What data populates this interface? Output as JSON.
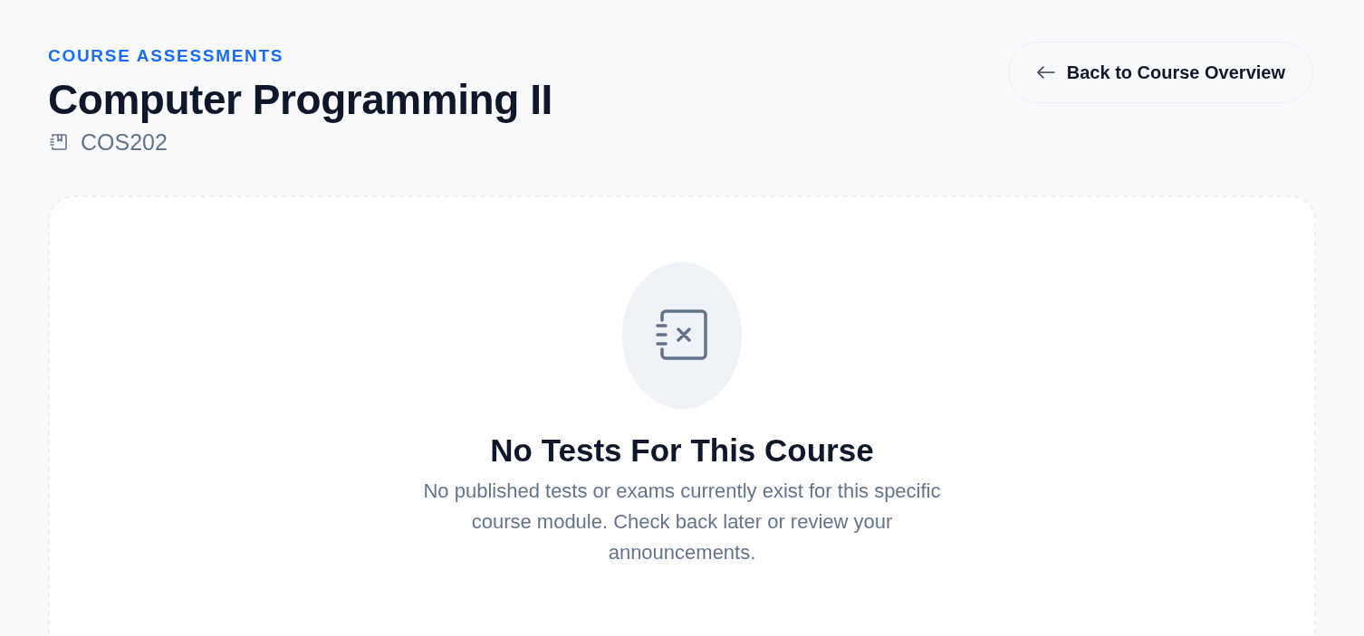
{
  "header": {
    "eyebrow": "COURSE ASSESSMENTS",
    "title": "Computer Programming II",
    "code": "COS202"
  },
  "back_button": {
    "label": "Back to Course Overview"
  },
  "empty_state": {
    "title": "No Tests For This Course",
    "message": "No published tests or exams currently exist for this specific course module. Check back later or review your announcements."
  }
}
